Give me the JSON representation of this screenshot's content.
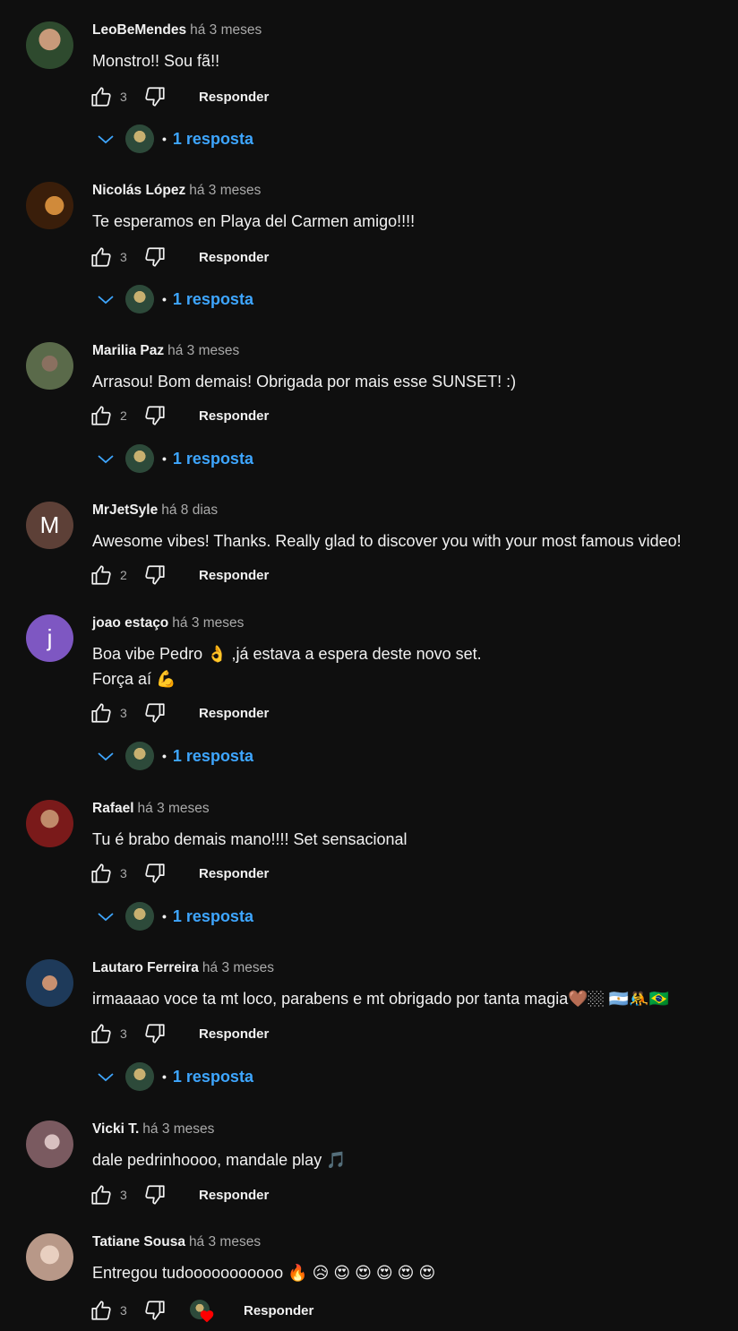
{
  "comments": [
    {
      "author": "LeoBeMendes",
      "time": "há 3 meses",
      "text": "Monstro!! Sou fã!!",
      "likes": "3",
      "reply_label": "Responder",
      "replies": "1 resposta",
      "avatar_color": "#3a5a3a"
    },
    {
      "author": "Nicolás López",
      "time": "há 3 meses",
      "text": "Te esperamos en Playa del Carmen amigo!!!!",
      "likes": "3",
      "reply_label": "Responder",
      "replies": "1 resposta",
      "avatar_color": "#6b3a12"
    },
    {
      "author": "Marilia Paz",
      "time": "há 3 meses",
      "text": "Arrasou! Bom demais! Obrigada por mais esse SUNSET! :)",
      "likes": "2",
      "reply_label": "Responder",
      "replies": "1 resposta",
      "avatar_color": "#4a5a3a"
    },
    {
      "author": "MrJetSyle",
      "time": "há 8 dias",
      "text": "Awesome vibes! Thanks. Really glad to discover you with your most famous video!",
      "likes": "2",
      "reply_label": "Responder",
      "avatar_letter": "M",
      "avatar_color": "#5d4037"
    },
    {
      "author": "joao estaço",
      "time": "há 3 meses",
      "text": "Boa vibe Pedro 👌 ,já estava a espera deste novo set.\nForça aí 💪",
      "likes": "3",
      "reply_label": "Responder",
      "replies": "1 resposta",
      "avatar_letter": "j",
      "avatar_color": "#7e57c2"
    },
    {
      "author": "Rafael",
      "time": "há 3 meses",
      "text": "Tu é brabo demais mano!!!! Set sensacional",
      "likes": "3",
      "reply_label": "Responder",
      "replies": "1 resposta",
      "avatar_color": "#7a2a22"
    },
    {
      "author": "Lautaro Ferreira",
      "time": "há 3 meses",
      "text": "irmaaaao voce ta mt loco, parabens e mt obrigado por tanta magia🤎🏼 🇦🇷🤼🇧🇷",
      "likes": "3",
      "reply_label": "Responder",
      "replies": "1 resposta",
      "avatar_color": "#2a4a6a"
    },
    {
      "author": "Vicki T.",
      "time": "há 3 meses",
      "text": "dale pedrinhoooo, mandale play 🎵",
      "likes": "3",
      "reply_label": "Responder",
      "avatar_color": "#8a6a6e"
    },
    {
      "author": "Tatiane Sousa",
      "time": "há 3 meses",
      "text": "Entregou tudooooooooooo 🔥 😥 😍 😍 😍 😍 😍",
      "likes": "3",
      "reply_label": "Responder",
      "avatar_color": "#d9c3b5"
    }
  ],
  "colors": {
    "background": "#0f0f0f",
    "link": "#3ea6ff",
    "secondary_text": "#aaaaaa",
    "heart": "#ff0000"
  },
  "icons": [
    "thumb-up-icon",
    "thumb-down-icon",
    "chevron-down-icon",
    "heart-icon"
  ]
}
